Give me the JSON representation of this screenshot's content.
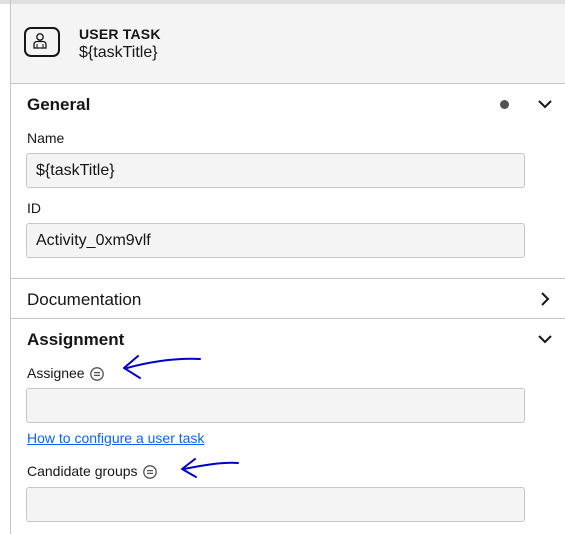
{
  "header": {
    "element_type": "USER TASK",
    "element_name": "${taskTitle}",
    "icon": "user-task-icon"
  },
  "general": {
    "title": "General",
    "name_label": "Name",
    "name_value": "${taskTitle}",
    "id_label": "ID",
    "id_value": "Activity_0xm9vlf"
  },
  "documentation": {
    "title": "Documentation"
  },
  "assignment": {
    "title": "Assignment",
    "assignee_label": "Assignee",
    "assignee_value": "",
    "help_link": "How to configure a user task",
    "candidate_groups_label": "Candidate groups",
    "candidate_groups_value": ""
  },
  "colors": {
    "link": "#0f62fe",
    "annotation_arrow": "#0000c8",
    "header_bg": "#f4f4f4",
    "field_bg": "#f4f4f4"
  }
}
